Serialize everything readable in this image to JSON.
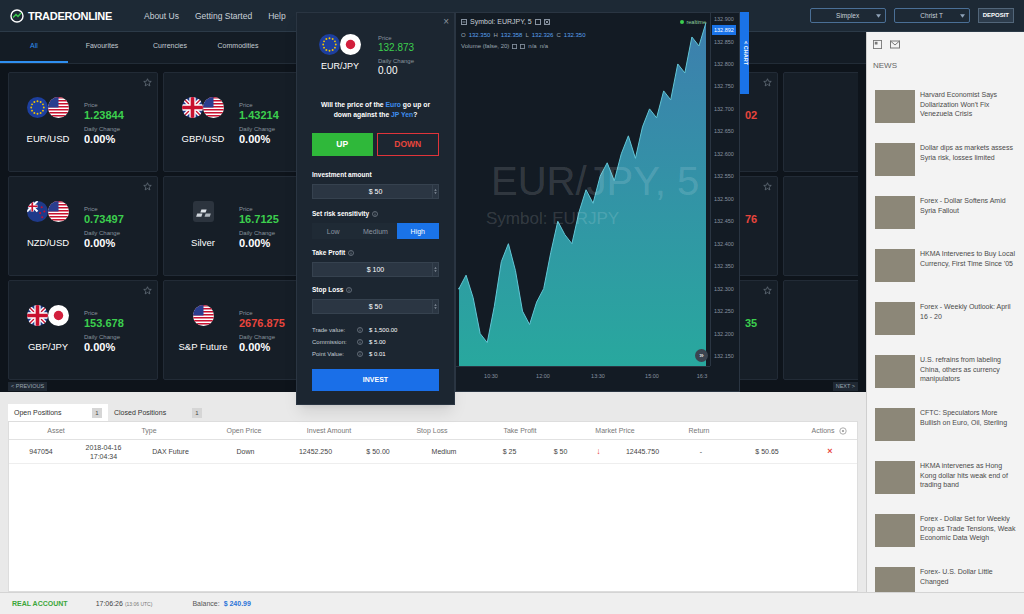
{
  "header": {
    "logo": "TRADERONLINE",
    "links": [
      "About Us",
      "Getting Started",
      "Help"
    ],
    "selects": [
      "Simplex",
      "Christ T"
    ],
    "deposit": "DEPOSIT"
  },
  "tabs": [
    {
      "label": "All",
      "selected": true
    },
    {
      "label": "Favourites",
      "selected": false
    },
    {
      "label": "Currencies",
      "selected": false
    },
    {
      "label": "Commodities",
      "selected": false
    }
  ],
  "cards": [
    [
      {
        "kind": "full",
        "name": "EUR/USD",
        "flags": [
          "eu",
          "us"
        ],
        "price_label": "Price",
        "price": "1.23844",
        "color": "#3ccf4e",
        "change_label": "Daily Change",
        "change": "0.00%"
      },
      {
        "kind": "full",
        "name": "GBP/USD",
        "flags": [
          "gb",
          "us"
        ],
        "price_label": "Price",
        "price": "1.43214",
        "color": "#3ccf4e",
        "change_label": "Daily Change",
        "change": "0.00%"
      },
      {
        "kind": "covered"
      },
      {
        "kind": "covered"
      },
      {
        "kind": "covered",
        "price": "02",
        "color": "#e8453c"
      },
      {
        "kind": "covered"
      }
    ],
    [
      {
        "kind": "full",
        "name": "NZD/USD",
        "flags": [
          "nz",
          "us"
        ],
        "price_label": "Price",
        "price": "0.73497",
        "color": "#3ccf4e",
        "change_label": "Daily Change",
        "change": "0.00%"
      },
      {
        "kind": "full",
        "name": "Silver",
        "flags": [
          "silver"
        ],
        "price_label": "Price",
        "price": "16.7125",
        "color": "#3ccf4e",
        "change_label": "Daily Change",
        "change": "0.00%"
      },
      {
        "kind": "covered"
      },
      {
        "kind": "covered"
      },
      {
        "kind": "covered",
        "price": "76",
        "color": "#e8453c"
      },
      {
        "kind": "covered"
      }
    ],
    [
      {
        "kind": "full",
        "name": "GBP/JPY",
        "flags": [
          "gb",
          "jp"
        ],
        "price_label": "Price",
        "price": "153.678",
        "color": "#3ccf4e",
        "change_label": "Daily Change",
        "change": "0.00%"
      },
      {
        "kind": "full",
        "name": "S&P Future",
        "flags": [
          "us"
        ],
        "price_label": "Price",
        "price": "2676.875",
        "color": "#e8453c",
        "change_label": "Daily Change",
        "change": "0.00%"
      },
      {
        "kind": "covered"
      },
      {
        "kind": "covered"
      },
      {
        "kind": "covered",
        "price": "35",
        "color": "#3ccf4e"
      },
      {
        "kind": "covered"
      }
    ]
  ],
  "pager": {
    "previous": "< PREVIOUS",
    "next": "NEXT >"
  },
  "modal": {
    "close": "×",
    "flags": [
      "eu",
      "jp"
    ],
    "symbol": "EUR/JPY",
    "price_label": "Price",
    "price": "132.873",
    "change_label": "Daily Change",
    "change": "0.00",
    "question": [
      {
        "text": "Will the price of the ",
        "highlight": false
      },
      {
        "text": "Euro",
        "highlight": true
      },
      {
        "text": " go up or down against the ",
        "highlight": false
      },
      {
        "text": "JP Yen",
        "highlight": true
      },
      {
        "text": "?",
        "highlight": false
      }
    ],
    "up": "UP",
    "down": "DOWN",
    "investment": {
      "label": "Investment amount",
      "value": "$ 50"
    },
    "risk": {
      "label": "Set risk sensitivity",
      "options": [
        {
          "label": "Low",
          "selected": false
        },
        {
          "label": "Medium",
          "selected": false
        },
        {
          "label": "High",
          "selected": true
        }
      ]
    },
    "take_profit": {
      "label": "Take Profit",
      "value": "$ 100"
    },
    "stop_loss": {
      "label": "Stop Loss",
      "value": "$ 50"
    },
    "summary": [
      {
        "label": "Trade value:",
        "value": "$ 1,500.00"
      },
      {
        "label": "Commission:",
        "value": "$ 5.00"
      },
      {
        "label": "Point Value:",
        "value": "$ 0.01"
      }
    ],
    "invest": "INVEST"
  },
  "chart": {
    "title": "Symbol: EURJPY, 5",
    "status": "realtime",
    "ohlc": [
      {
        "label": "O",
        "value": "132.350"
      },
      {
        "label": "H",
        "value": "132.358"
      },
      {
        "label": "L",
        "value": "132.326"
      },
      {
        "label": "C",
        "value": "132.350"
      }
    ],
    "volume": "Volume (false, 20)",
    "volume_values": [
      "n/a",
      "n/a"
    ],
    "watermark": "EUR/JPY, 5",
    "watermark_sub": "Symbol: EURJPY",
    "y_ticks": [
      "132.900",
      "132.850",
      "132.800",
      "132.750",
      "132.700",
      "132.650",
      "132.600",
      "132.550",
      "132.500",
      "132.450",
      "132.400",
      "132.350",
      "132.300",
      "132.250",
      "132.200",
      "132.150"
    ],
    "x_ticks": [
      "10:30",
      "12:00",
      "13:30",
      "15:00",
      "16:3"
    ],
    "price_tag": "132.892",
    "series": [
      132.3,
      132.33,
      132.28,
      132.2,
      132.18,
      132.26,
      132.36,
      132.4,
      132.34,
      132.25,
      132.22,
      132.27,
      132.3,
      132.38,
      132.45,
      132.42,
      132.4,
      132.47,
      132.52,
      132.49,
      132.55,
      132.58,
      132.54,
      132.6,
      132.64,
      132.59,
      132.66,
      132.7,
      132.68,
      132.74,
      132.72,
      132.8,
      132.78,
      132.86,
      132.84,
      132.892
    ],
    "tab": "< CHART",
    "scroll": "»"
  },
  "positions": {
    "tabs": [
      {
        "label": "Open Positions",
        "count": "1",
        "selected": true
      },
      {
        "label": "Closed Positions",
        "count": "1",
        "selected": false
      }
    ],
    "columns": [
      "Asset",
      "Type",
      "Open Price",
      "Invest Amount",
      "Stop Loss",
      "Take Profit",
      "Market Price",
      "Return",
      "Actions"
    ],
    "rows": [
      [
        {
          "text": "947054"
        },
        {
          "text": "2018-04-16 17:04:34"
        },
        {
          "text": "DAX Future"
        },
        {
          "text": "Down"
        },
        {
          "text": "12452.250"
        },
        {
          "text": "$ 50.00"
        },
        {
          "text": "Medium"
        },
        {
          "text": "$ 25"
        },
        {
          "text": "$ 50"
        },
        {
          "text": "↓",
          "color": "#e8453c"
        },
        {
          "text": "12445.750"
        },
        {
          "text": "-"
        },
        {
          "text": "$ 50.65"
        },
        {
          "text": "×",
          "color": "#e8453c"
        }
      ]
    ]
  },
  "news": {
    "title": "NEWS",
    "items": [
      "Harvard Economist Says Dollarization Won't Fix Venezuela Crisis",
      "Dollar dips as markets assess Syria risk, losses limited",
      "Forex - Dollar Softens Amid Syria Fallout",
      "HKMA Intervenes to Buy Local Currency, First Time Since '05",
      "Forex - Weekly Outlook: April 16 - 20",
      "U.S. refrains from labeling China, others as currency manipulators",
      "CFTC: Speculators More Bullish on Euro, Oil, Sterling",
      "HKMA intervenes as Hong Kong dollar hits weak end of trading band",
      "Forex - Dollar Set for Weekly Drop as Trade Tensions, Weak Economic Data Weigh",
      "Forex- U.S. Dollar Little Changed"
    ]
  },
  "status_bar": {
    "account": "REAL ACCOUNT",
    "time": "17:06:26",
    "utc": "(13:06 UTC)",
    "balance_label": "Balance:",
    "balance": "$ 240.99"
  }
}
